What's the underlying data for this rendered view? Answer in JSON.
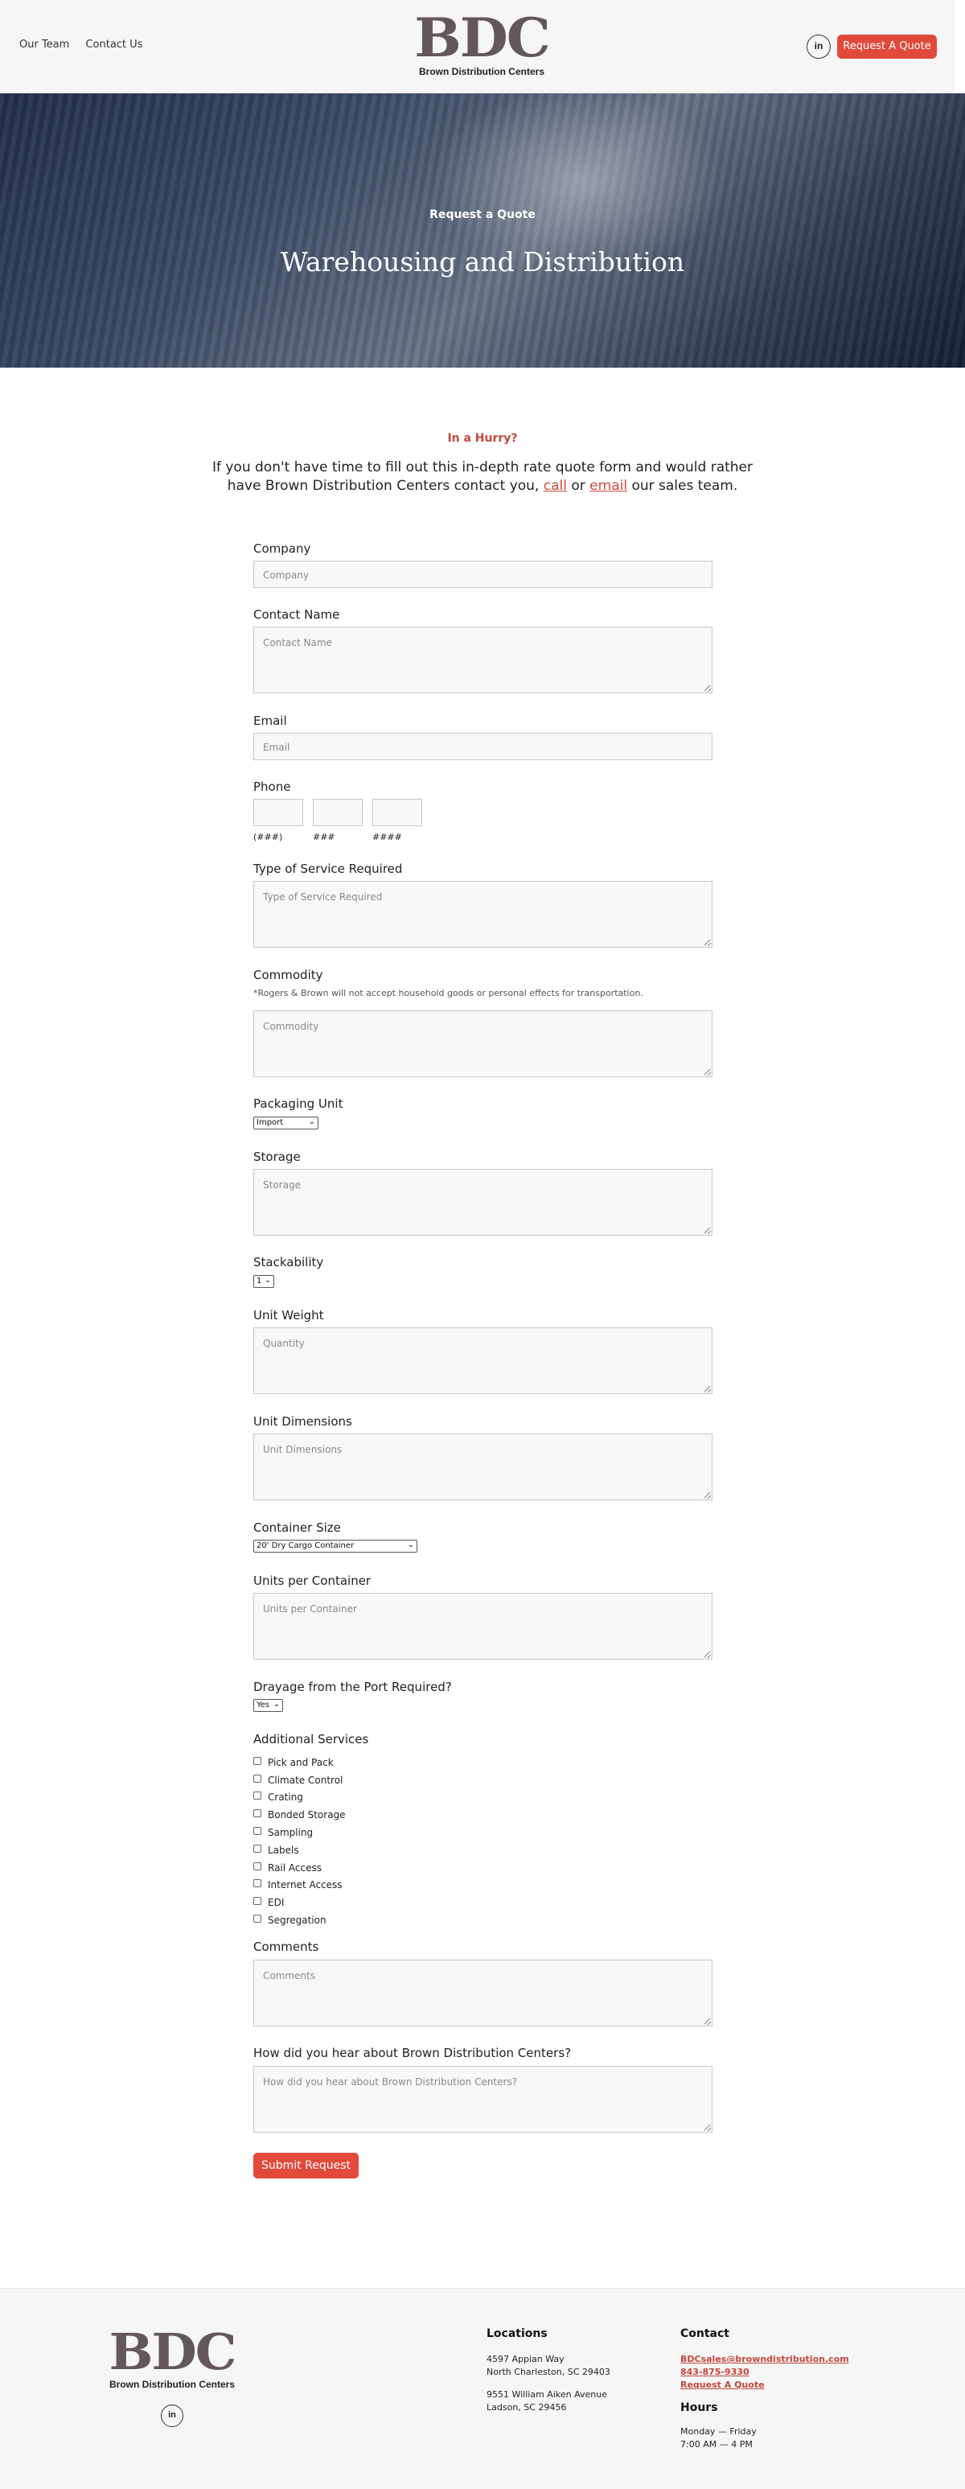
{
  "header": {
    "nav": [
      "Our Team",
      "Contact Us"
    ],
    "logo_mark": "BDC",
    "logo_sub": "Brown Distribution Centers",
    "linkedin": "in",
    "cta": "Request A Quote"
  },
  "hero": {
    "eyebrow": "Request a Quote",
    "title": "Warehousing and Distribution"
  },
  "hurry": {
    "label": "In a Hurry?",
    "text_before": "If you don't have time to fill out this in-depth rate quote form and would rather have Brown Distribution Centers contact you,",
    "call": "call",
    "or": "or",
    "email": "email",
    "text_after": "our sales team."
  },
  "form": {
    "company": {
      "label": "Company",
      "placeholder": "Company"
    },
    "contact_name": {
      "label": "Contact Name",
      "placeholder": "Contact Name"
    },
    "email": {
      "label": "Email",
      "placeholder": "Email"
    },
    "phone": {
      "label": "Phone",
      "hints": [
        "(###)",
        "###",
        "####"
      ]
    },
    "service_type": {
      "label": "Type of Service Required",
      "placeholder": "Type of Service Required"
    },
    "commodity": {
      "label": "Commodity",
      "note": "*Rogers & Brown will not accept household goods or personal effects for transportation.",
      "placeholder": "Commodity"
    },
    "packaging_unit": {
      "label": "Packaging Unit",
      "value": "Import"
    },
    "storage": {
      "label": "Storage",
      "placeholder": "Storage"
    },
    "stackability": {
      "label": "Stackability",
      "value": "1"
    },
    "unit_weight": {
      "label": "Unit Weight",
      "placeholder": "Quantity"
    },
    "unit_dimensions": {
      "label": "Unit Dimensions",
      "placeholder": "Unit Dimensions"
    },
    "container_size": {
      "label": "Container Size",
      "value": "20' Dry Cargo Container"
    },
    "units_per_container": {
      "label": "Units per Container",
      "placeholder": "Units per Container"
    },
    "drayage": {
      "label": "Drayage from the Port Required?",
      "value": "Yes"
    },
    "additional_services": {
      "label": "Additional Services",
      "options": [
        "Pick and Pack",
        "Climate Control",
        "Crating",
        "Bonded Storage",
        "Sampling",
        "Labels",
        "Rail Access",
        "Internet Access",
        "EDI",
        "Segregation"
      ]
    },
    "comments": {
      "label": "Comments",
      "placeholder": "Comments"
    },
    "referral": {
      "label": "How did you hear about Brown Distribution Centers?",
      "placeholder": "How did you hear about Brown Distribution Centers?"
    },
    "submit": "Submit Request"
  },
  "footer": {
    "logo_mark": "BDC",
    "logo_sub": "Brown Distribution Centers",
    "linkedin": "in",
    "locations": {
      "heading": "Locations",
      "addresses": [
        [
          "4597 Appian Way",
          "North Charleston, SC 29403"
        ],
        [
          "9551 William Aiken Avenue",
          "Ladson, SC 29456"
        ]
      ]
    },
    "contact": {
      "heading": "Contact",
      "email": "BDCsales@browndistribution.com",
      "phone": "843-875-9330",
      "quote": "Request A Quote"
    },
    "hours": {
      "heading": "Hours",
      "days": "Monday — Friday",
      "time": "7:00 AM — 4 PM"
    }
  },
  "colors": {
    "accent": "#e14a3b",
    "logo": "#63575a",
    "link": "#c4473a"
  }
}
